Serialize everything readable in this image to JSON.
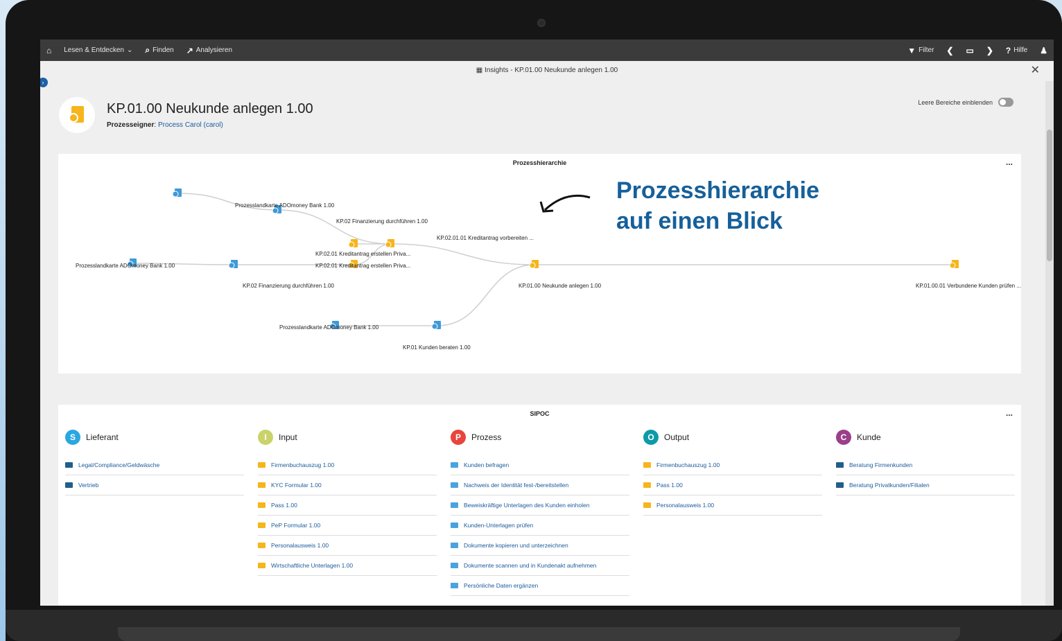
{
  "nav": {
    "read_explore": "Lesen & Entdecken",
    "find": "Finden",
    "analyze": "Analysieren",
    "filter": "Filter",
    "help": "Hilfe"
  },
  "window": {
    "title": "Insights - KP.01.00 Neukunde anlegen 1.00"
  },
  "header": {
    "title": "KP.01.00 Neukunde anlegen 1.00",
    "owner_label": "Prozesseigner",
    "owner_value": "Process Carol (carol)",
    "empty_toggle_label": "Leere Bereiche einblenden"
  },
  "hierarchy": {
    "title": "Prozesshierarchie",
    "more": "...",
    "callout_line1": "Prozesshierarchie",
    "callout_line2": "auf einen Blick",
    "nodes": [
      {
        "label": "Prozesslandkarte ADOmoney Bank 1.00",
        "kind": "map"
      },
      {
        "label": "KP.02 Finanzierung durchführen 1.00",
        "kind": "map"
      },
      {
        "label": "KP.02.01.01 Kreditantrag vorbereiten ...",
        "kind": "process"
      },
      {
        "label": "KP.02.01 Kreditantrag erstellen Priva...",
        "kind": "process"
      },
      {
        "label": "Prozesslandkarte ADOmoney Bank 1.00",
        "kind": "map"
      },
      {
        "label": "KP.02.01 Kreditantrag erstellen Priva...",
        "kind": "process"
      },
      {
        "label": "KP.02 Finanzierung durchführen 1.00",
        "kind": "map"
      },
      {
        "label": "KP.01.00 Neukunde anlegen 1.00",
        "kind": "process"
      },
      {
        "label": "KP.01.00.01 Verbundene Kunden prüfen ...",
        "kind": "process"
      },
      {
        "label": "Prozesslandkarte ADOmoney Bank 1.00",
        "kind": "map"
      },
      {
        "label": "KP.01 Kunden beraten 1.00",
        "kind": "map"
      }
    ]
  },
  "sipoc": {
    "title": "SIPOC",
    "more": "...",
    "columns": [
      {
        "letter": "S",
        "title": "Lieferant",
        "color": "#2aa7e0",
        "swatch": "#1f5f8c",
        "items": [
          "Legal/Compliance/Geldwäsche",
          "Vertrieb"
        ]
      },
      {
        "letter": "I",
        "title": "Input",
        "color": "#c9d36a",
        "swatch": "#f6b51b",
        "items": [
          "Firmenbuchauszug 1.00",
          "KYC Formular 1.00",
          "Pass 1.00",
          "PeP Formular 1.00",
          "Personalausweis 1.00",
          "Wirtschaftliche Unterlagen 1.00"
        ]
      },
      {
        "letter": "P",
        "title": "Prozess",
        "color": "#e8453c",
        "swatch": "#4aa3df",
        "items": [
          "Kunden befragen",
          "Nachweis der Identität fest-/bereitstellen",
          "Beweiskräftige Unterlagen des Kunden einholen",
          "Kunden-Unterlagen prüfen",
          "Dokumente kopieren und unterzeichnen",
          "Dokumente scannen und in Kundenakt aufnehmen",
          "Persönliche Daten ergänzen"
        ]
      },
      {
        "letter": "O",
        "title": "Output",
        "color": "#0e9aa7",
        "swatch": "#f6b51b",
        "items": [
          "Firmenbuchauszug 1.00",
          "Pass 1.00",
          "Personalausweis 1.00"
        ]
      },
      {
        "letter": "C",
        "title": "Kunde",
        "color": "#9b3f8a",
        "swatch": "#1f5f8c",
        "items": [
          "Beratung Firmenkunden",
          "Beratung Privatkunden/Filialen"
        ]
      }
    ]
  }
}
